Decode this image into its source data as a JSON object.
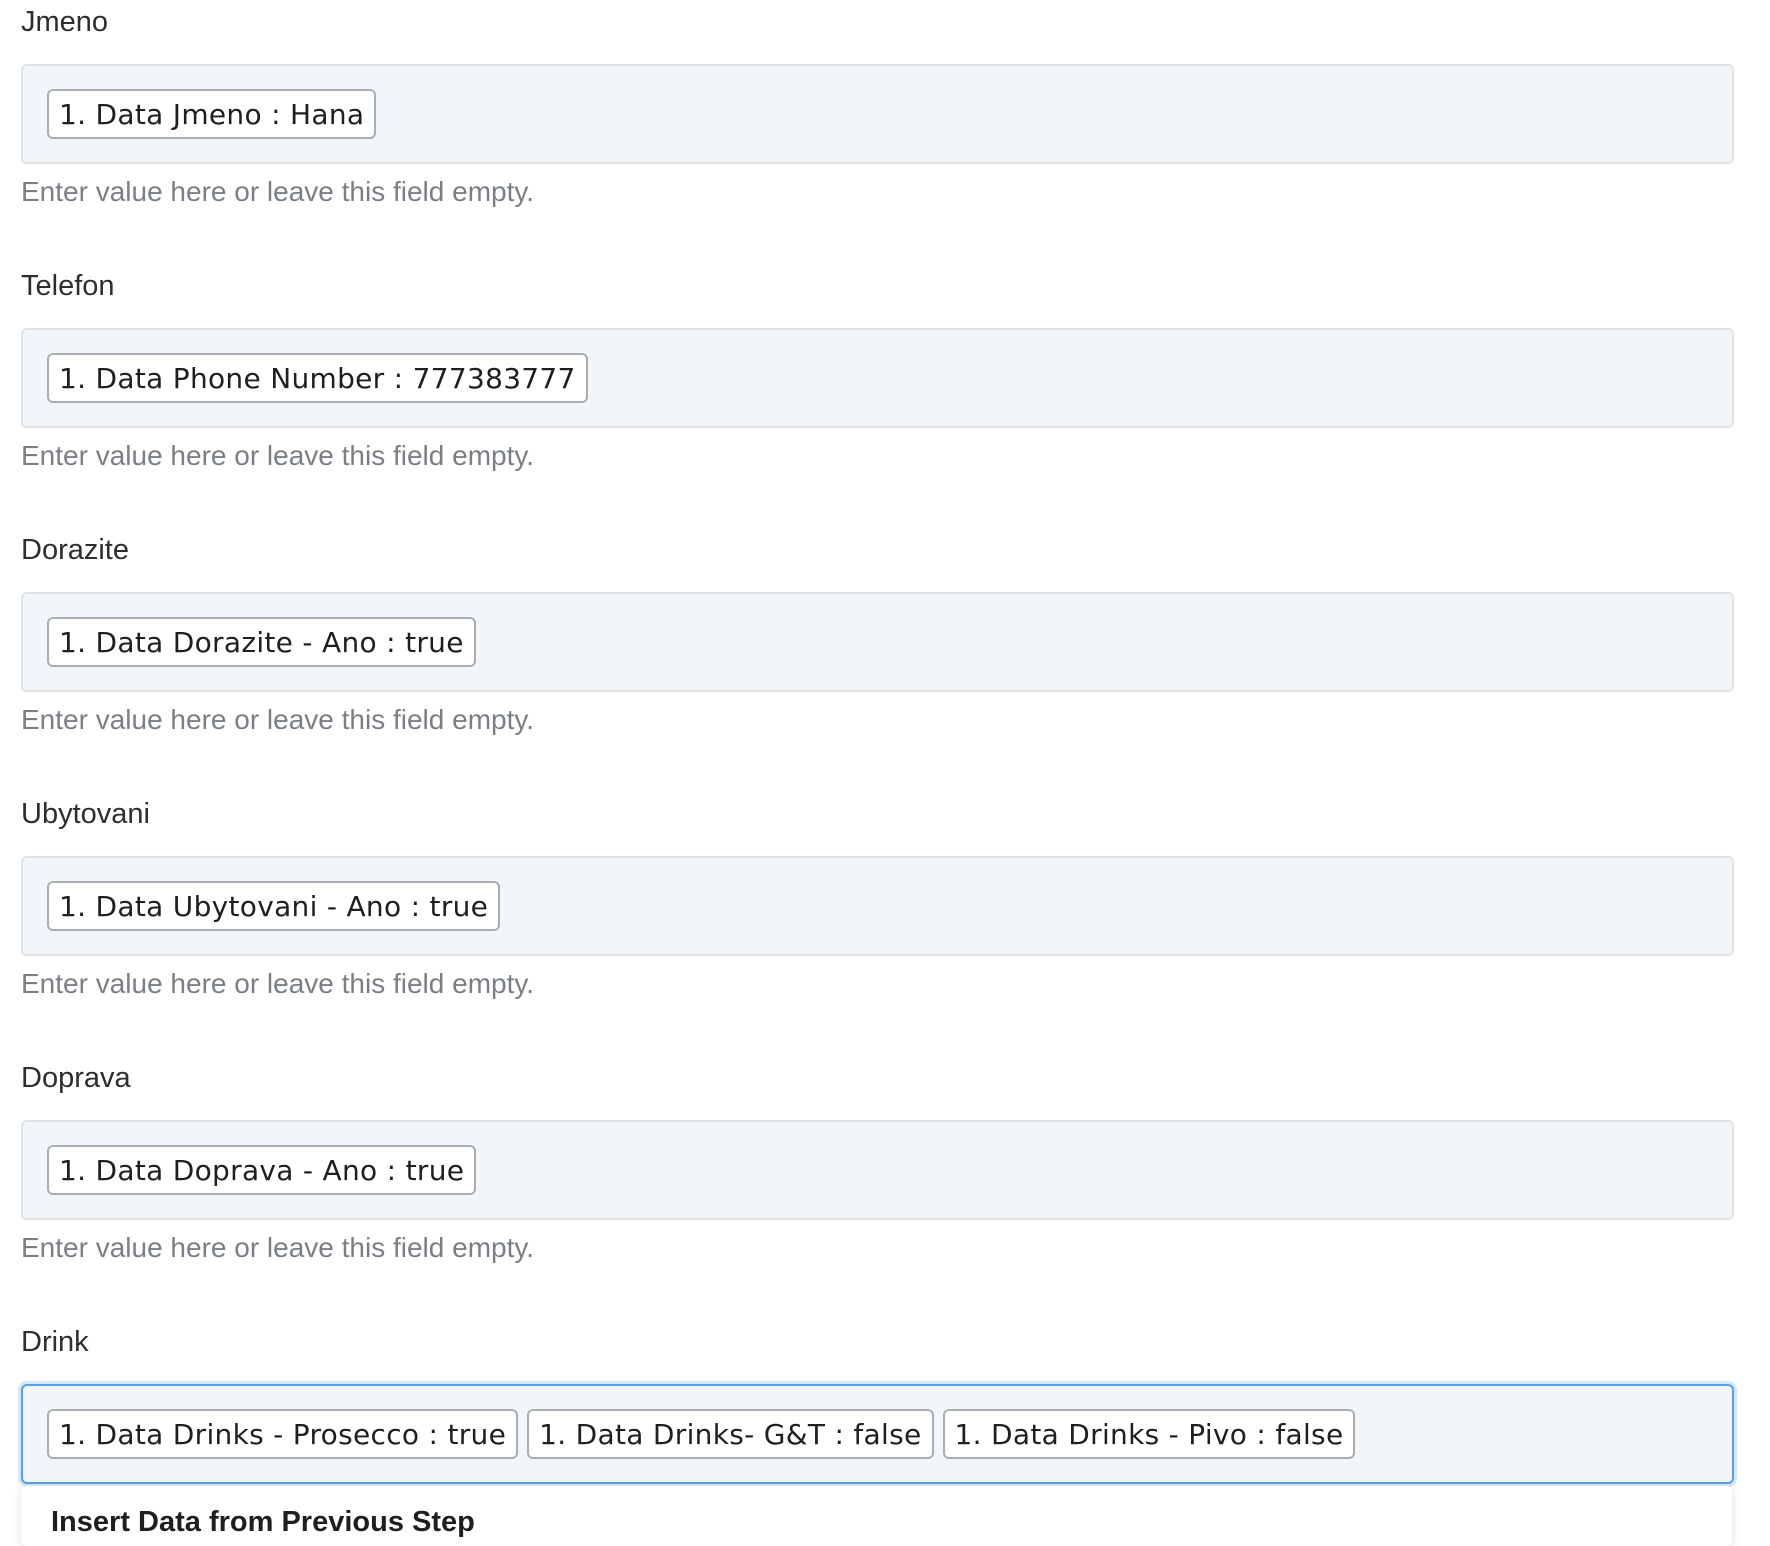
{
  "fields": [
    {
      "label": "Jmeno",
      "pills": [
        "1. Data Jmeno : Hana"
      ],
      "hint": "Enter value here or leave this field empty."
    },
    {
      "label": "Telefon",
      "pills": [
        "1. Data Phone Number : 777383777"
      ],
      "hint": "Enter value here or leave this field empty."
    },
    {
      "label": "Dorazite",
      "pills": [
        "1. Data Dorazite - Ano : true"
      ],
      "hint": "Enter value here or leave this field empty."
    },
    {
      "label": "Ubytovani",
      "pills": [
        "1. Data Ubytovani - Ano : true"
      ],
      "hint": "Enter value here or leave this field empty."
    },
    {
      "label": "Doprava",
      "pills": [
        "1. Data Doprava - Ano : true"
      ],
      "hint": "Enter value here or leave this field empty."
    },
    {
      "label": "Drink",
      "pills": [
        "1. Data Drinks - Prosecco : true",
        "1. Data Drinks- G&T : false",
        "1. Data Drinks - Pivo : false"
      ],
      "focused": true
    }
  ],
  "dropdown": {
    "title": "Insert Data from Previous Step"
  }
}
